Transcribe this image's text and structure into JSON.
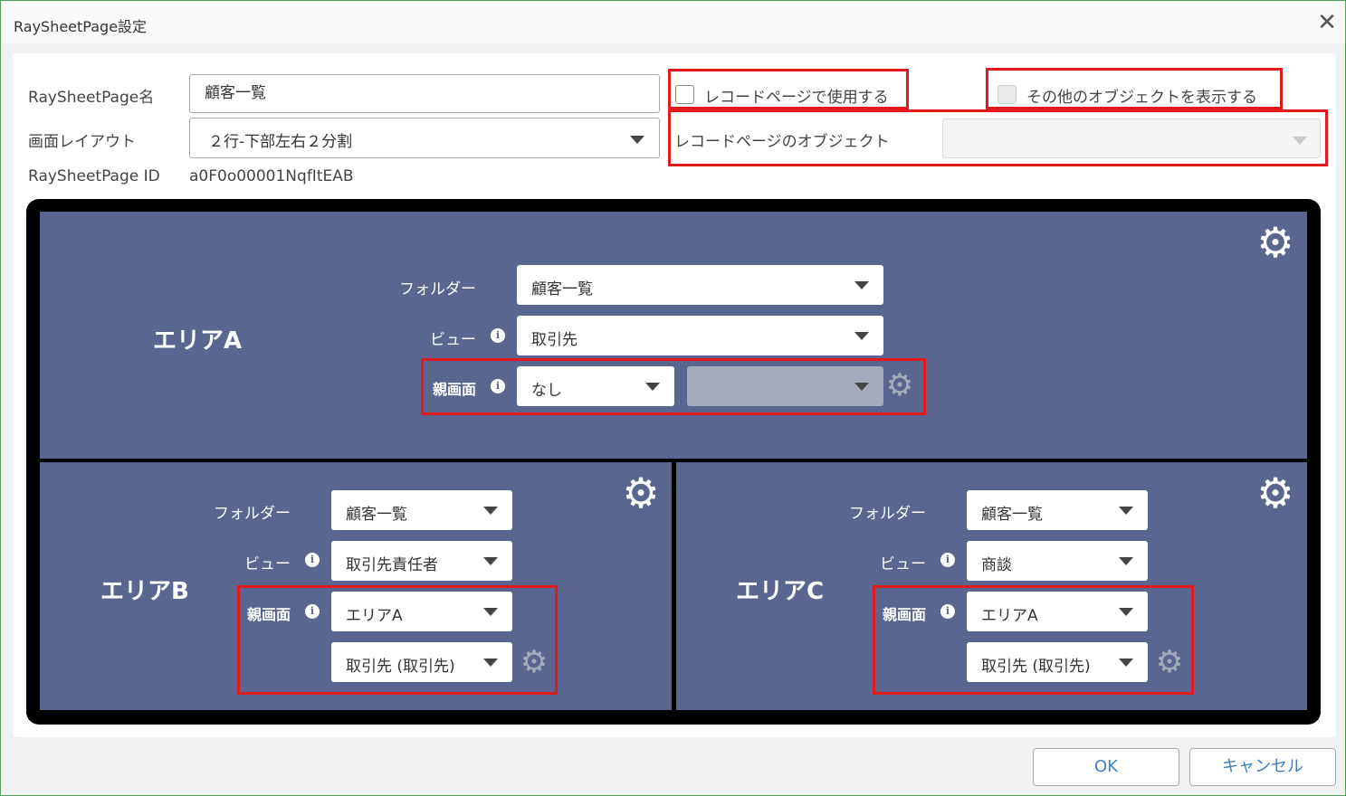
{
  "window": {
    "title": "RaySheetPage設定",
    "close_glyph": "✕"
  },
  "form": {
    "name_label": "RaySheetPage名",
    "name_value": "顧客一覧",
    "layout_label": "画面レイアウト",
    "layout_value": "２行-下部左右２分割",
    "id_label": "RaySheetPage ID",
    "id_value": "a0F0o00001NqfItEAB",
    "use_record_page_label": "レコードページで使用する",
    "use_record_page_checked": false,
    "show_other_objects_label": "その他のオブジェクトを表示する",
    "show_other_objects_checked": false,
    "record_page_object_label": "レコードページのオブジェクト",
    "record_page_object_value": ""
  },
  "areas": {
    "a": {
      "title": "エリアA",
      "folder_label": "フォルダー",
      "folder_value": "顧客一覧",
      "view_label": "ビュー",
      "view_value": "取引先",
      "parent_label": "親画面",
      "parent_value": "なし",
      "parent_sub_value": ""
    },
    "b": {
      "title": "エリアB",
      "folder_label": "フォルダー",
      "folder_value": "顧客一覧",
      "view_label": "ビュー",
      "view_value": "取引先責任者",
      "parent_label": "親画面",
      "parent_value": "エリアA",
      "parent_sub_value": "取引先 (取引先)"
    },
    "c": {
      "title": "エリアC",
      "folder_label": "フォルダー",
      "folder_value": "顧客一覧",
      "view_label": "ビュー",
      "view_value": "商談",
      "parent_label": "親画面",
      "parent_value": "エリアA",
      "parent_sub_value": "取引先 (取引先)"
    }
  },
  "icons": {
    "gear": "⚙",
    "info": "i"
  },
  "buttons": {
    "ok": "OK",
    "cancel": "キャンセル"
  },
  "colors": {
    "area_bg": "#5a6690",
    "highlight": "#e3191c",
    "button_text": "#3f7fc6"
  }
}
